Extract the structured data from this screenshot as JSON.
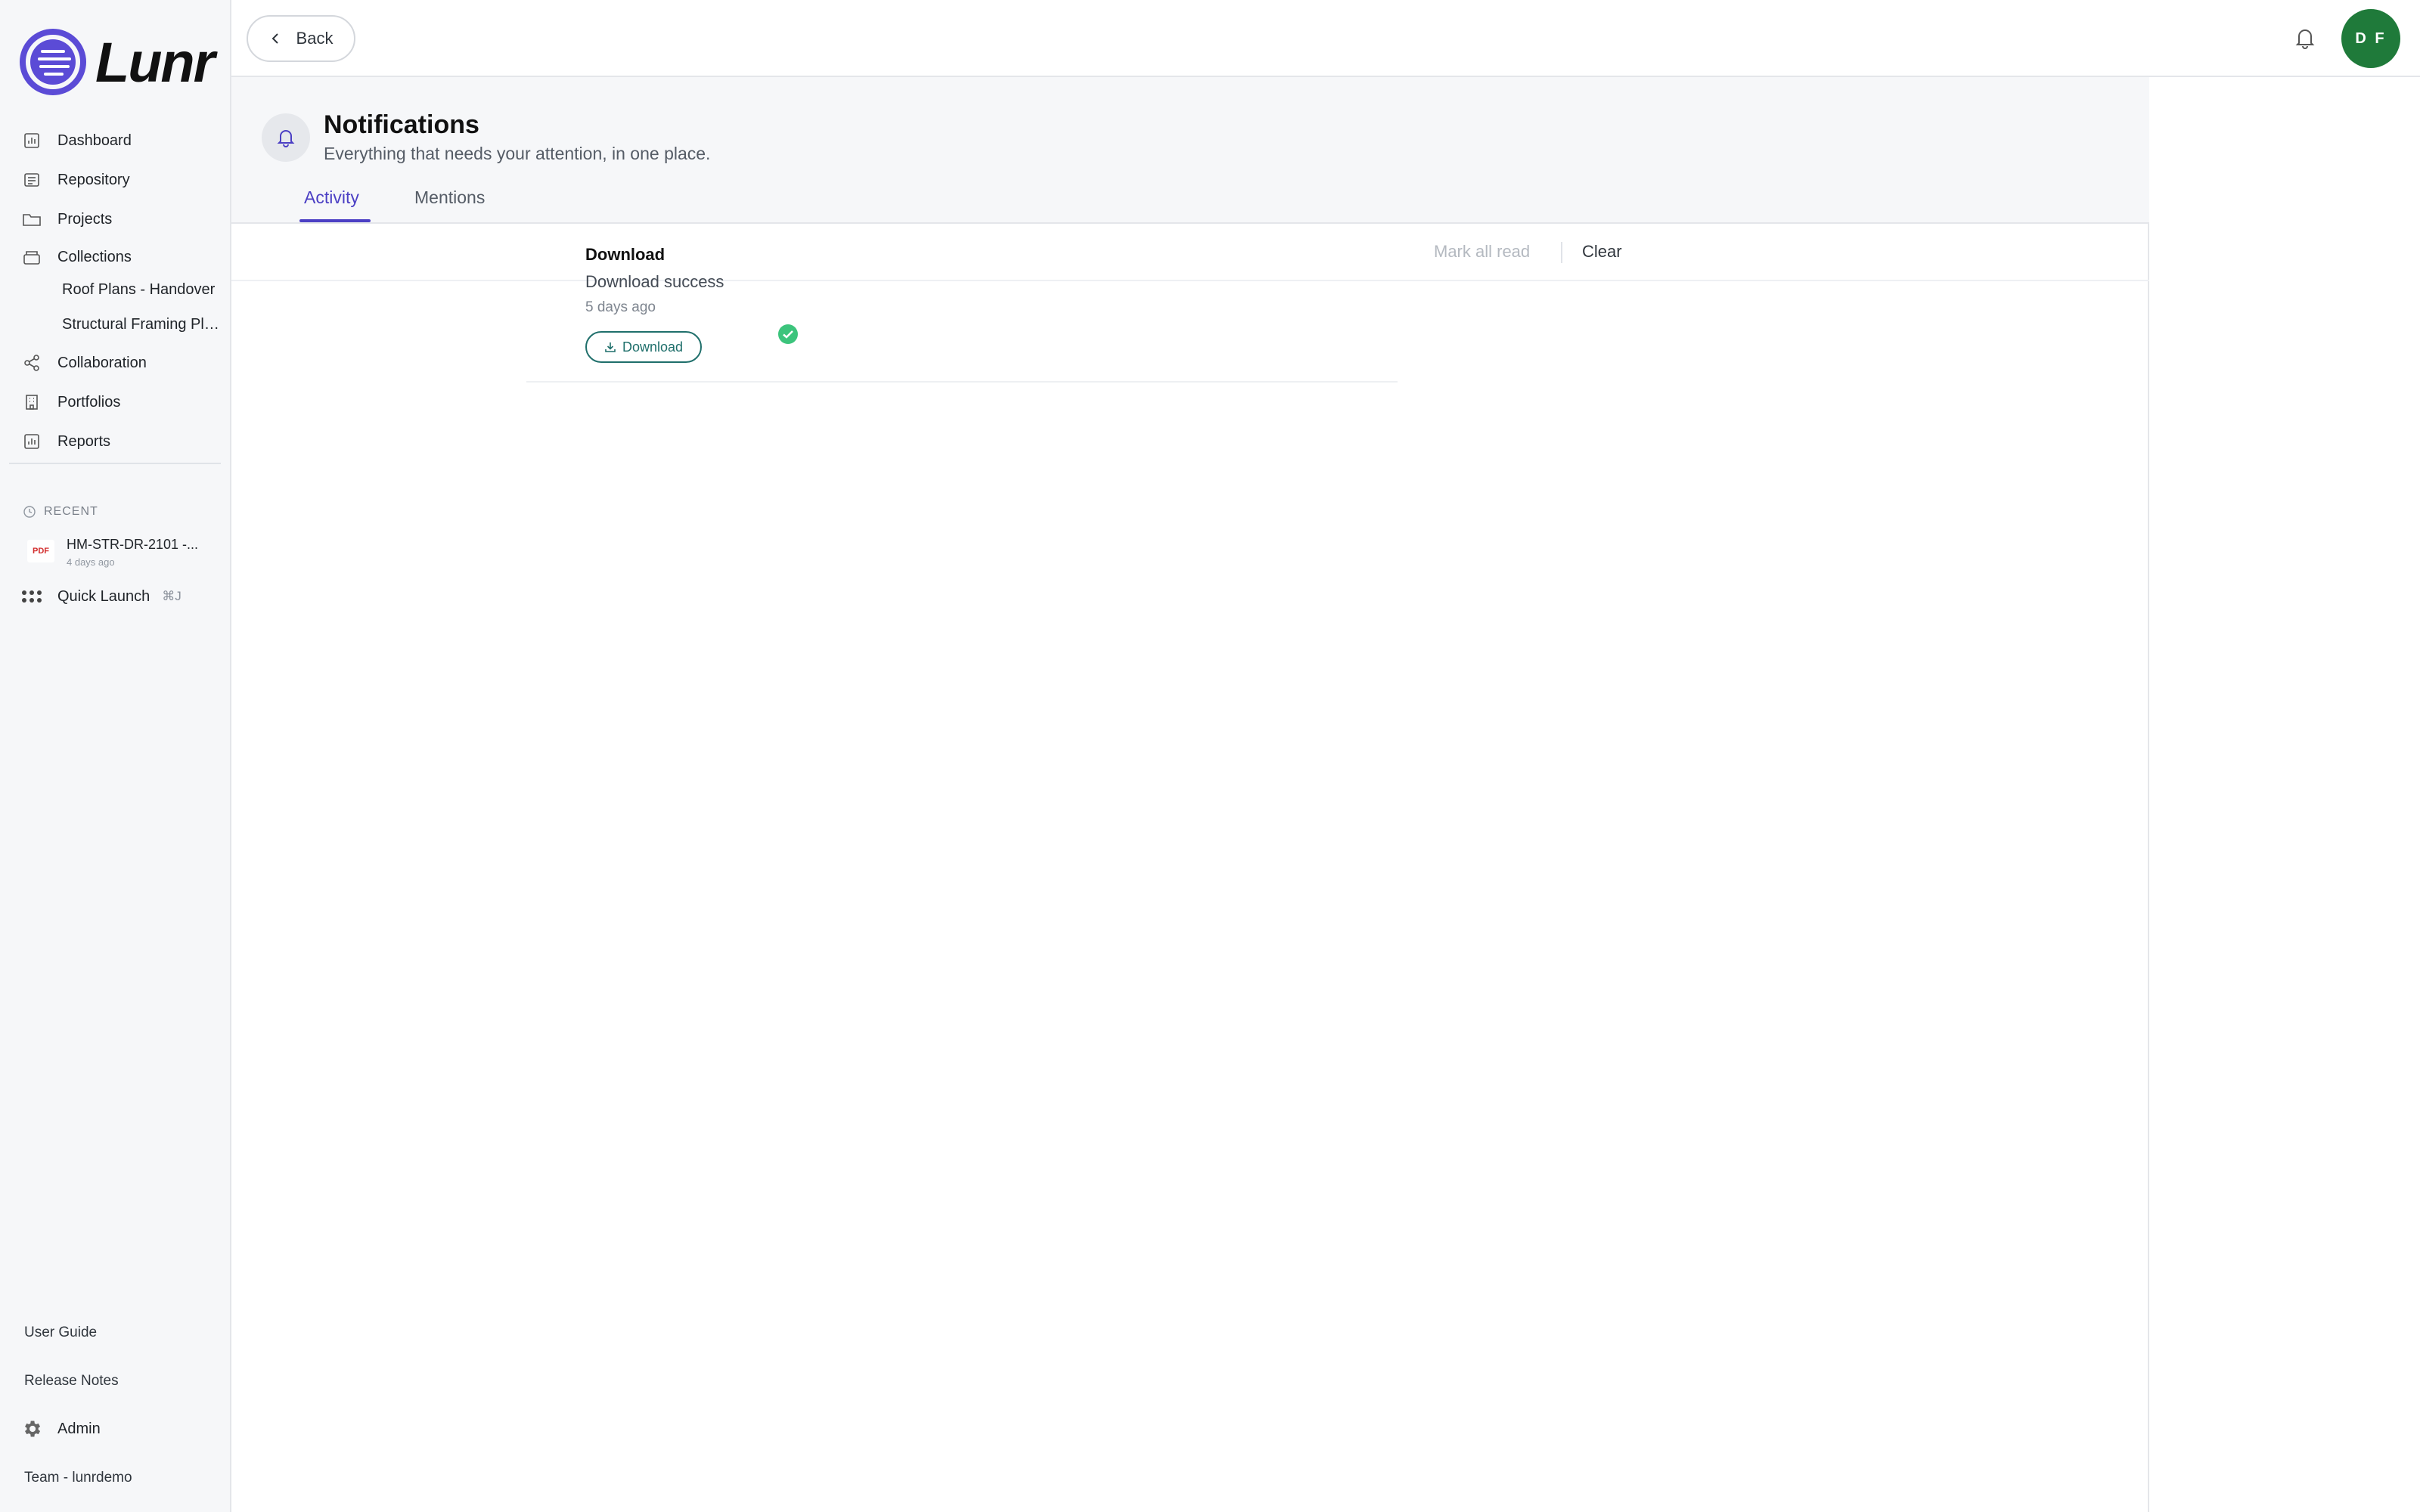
{
  "app": {
    "name": "Lunr"
  },
  "topbar": {
    "back_label": "Back",
    "avatar_initials": "D F",
    "avatar_color": "#1f7a3a"
  },
  "sidebar": {
    "items": [
      {
        "label": "Dashboard",
        "icon": "chart-icon"
      },
      {
        "label": "Repository",
        "icon": "repository-icon"
      },
      {
        "label": "Projects",
        "icon": "folder-icon"
      },
      {
        "label": "Collections",
        "icon": "collection-icon"
      },
      {
        "label": "Collaboration",
        "icon": "share-icon"
      },
      {
        "label": "Portfolios",
        "icon": "building-icon"
      },
      {
        "label": "Reports",
        "icon": "chart-icon"
      }
    ],
    "collections": [
      "Roof Plans - Handover",
      "Structural Framing Plans"
    ],
    "recent": {
      "header": "RECENT",
      "file": {
        "type": "PDF",
        "name": "HM-STR-DR-2101 -...",
        "time": "4 days ago"
      }
    },
    "quick_launch": {
      "label": "Quick Launch",
      "shortcut": "⌘J"
    },
    "footer": {
      "user_guide": "User Guide",
      "release_notes": "Release Notes",
      "admin": "Admin",
      "team": "Team - lunrdemo"
    }
  },
  "page": {
    "title": "Notifications",
    "subtitle": "Everything that needs your attention, in one place.",
    "tabs": [
      {
        "label": "Activity",
        "active": true
      },
      {
        "label": "Mentions",
        "active": false
      }
    ],
    "actions": {
      "mark_all_read": "Mark all read",
      "clear": "Clear"
    }
  },
  "notifications": [
    {
      "title": "Download",
      "body": "Download success",
      "time": "5 days ago",
      "button": "Download",
      "status_color": "#3cc47c"
    }
  ],
  "colors": {
    "accent": "#4b3fc4",
    "button_teal": "#1f6f6b"
  }
}
